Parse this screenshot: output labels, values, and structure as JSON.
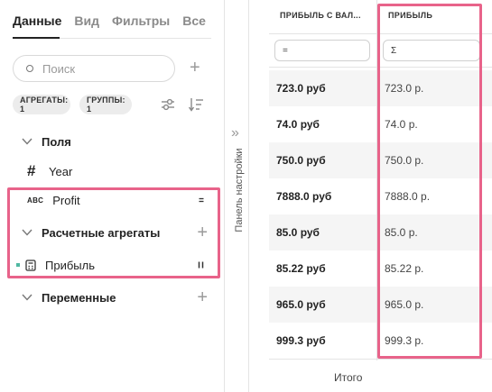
{
  "tabs": [
    {
      "label": "Данные",
      "active": true
    },
    {
      "label": "Вид",
      "active": false
    },
    {
      "label": "Фильтры",
      "active": false
    },
    {
      "label": "Все",
      "active": false
    }
  ],
  "search": {
    "placeholder": "Поиск"
  },
  "chips": {
    "aggregates": "АГРЕГАТЫ: 1",
    "groups": "ГРУППЫ: 1"
  },
  "sections": {
    "fields": "Поля",
    "year": "Year",
    "profit": "Profit",
    "calc_aggregates": "Расчетные агрегаты",
    "profit_measure": "Прибыль",
    "variables": "Переменные"
  },
  "settings_panel": {
    "label": "Панель настройки"
  },
  "table": {
    "headers": [
      "ПРИБЫЛЬ С ВАЛ...",
      "ПРИБЫЛЬ"
    ],
    "filter_symbols": [
      "=",
      "Σ"
    ],
    "rows": [
      [
        "723.0 руб",
        "723.0 р."
      ],
      [
        "74.0 руб",
        "74.0 р."
      ],
      [
        "750.0 руб",
        "750.0 р."
      ],
      [
        "7888.0 руб",
        "7888.0 р."
      ],
      [
        "85.0 руб",
        "85.0 р."
      ],
      [
        "85.22 руб",
        "85.22 р."
      ],
      [
        "965.0 руб",
        "965.0 р."
      ],
      [
        "999.3 руб",
        "999.3 р."
      ]
    ],
    "footer": "Итого"
  },
  "colors": {
    "highlight": "#e8638a",
    "accent_dot": "#4fb8a2"
  }
}
